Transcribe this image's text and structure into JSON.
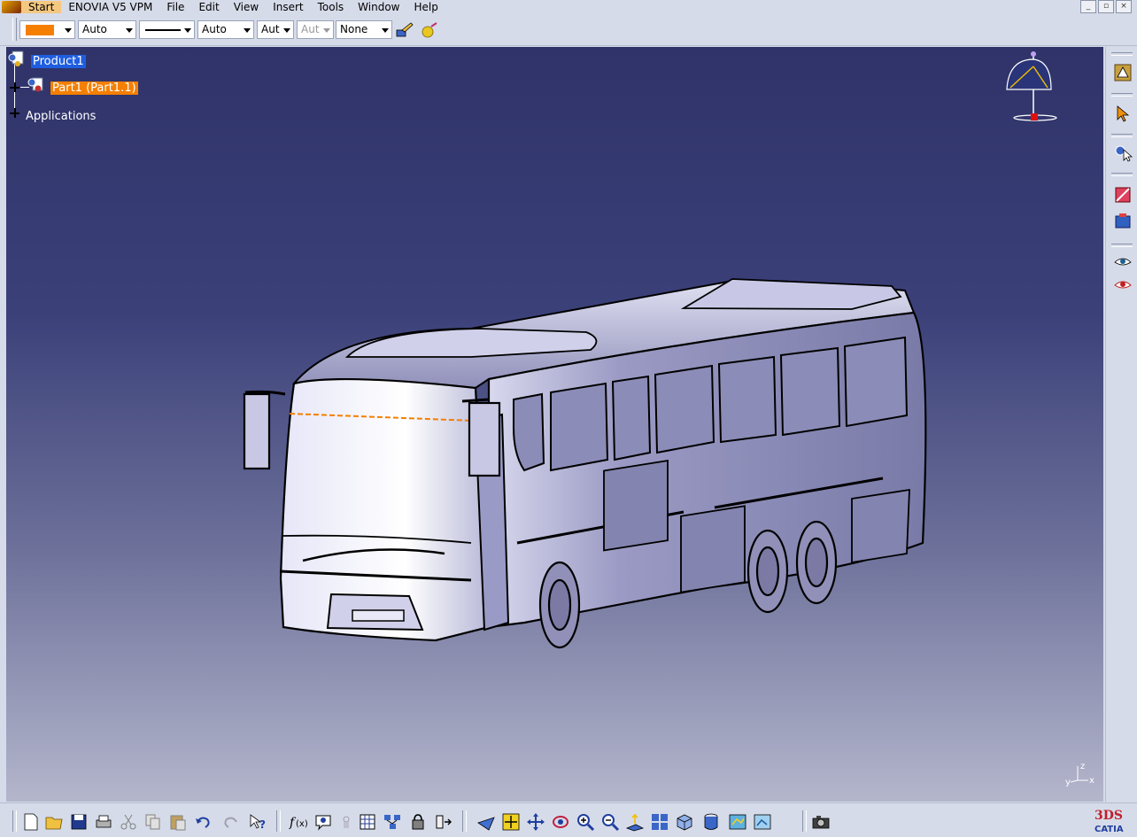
{
  "menubar": {
    "items": [
      "Start",
      "ENOVIA V5 VPM",
      "File",
      "Edit",
      "View",
      "Insert",
      "Tools",
      "Window",
      "Help"
    ],
    "window_controls": [
      "_",
      "▫",
      "×"
    ]
  },
  "properties_toolbar": {
    "fill_color": "#f57f00",
    "transparency_value": "Auto",
    "line_thickness_value": "Auto",
    "point_symbol_value": "Aut",
    "linetype_value": "Aut",
    "layer_value": "None"
  },
  "tree": {
    "root": "Product1",
    "part": "Part1 (Part1.1)",
    "applications": "Applications"
  },
  "compass": {
    "axis_z": "z",
    "axis_x": "x",
    "axis_y": "y"
  },
  "brand": {
    "logo_text": "CATIA",
    "logo_mark": "3DS"
  },
  "colors": {
    "background_top": "#2f3369",
    "background_bottom": "#b4b6cc",
    "selection": "#1f5ee0",
    "highlight": "#f57f00",
    "toolbar": "#d6dbe9"
  }
}
